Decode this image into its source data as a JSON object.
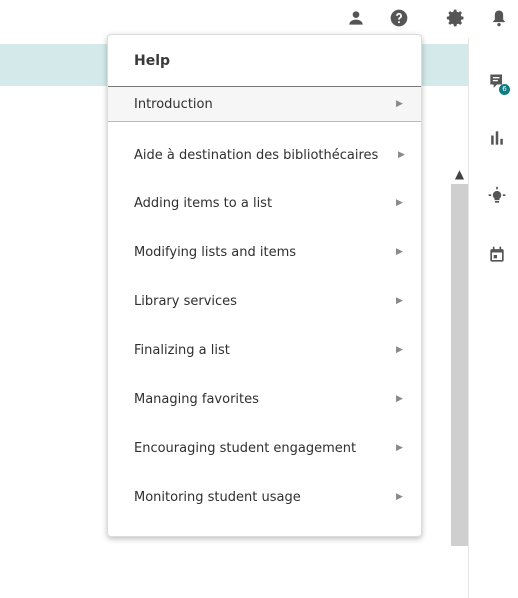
{
  "menu": {
    "title": "Help",
    "items": [
      {
        "label": "Introduction"
      },
      {
        "label": "Aide à destination des bibliothécaires"
      },
      {
        "label": "Adding items to a list"
      },
      {
        "label": "Modifying lists and items"
      },
      {
        "label": "Library services"
      },
      {
        "label": "Finalizing a list"
      },
      {
        "label": "Managing favorites"
      },
      {
        "label": "Encouraging student engagement"
      },
      {
        "label": "Monitoring student usage"
      }
    ],
    "chevron": "▶"
  },
  "sidebar": {
    "notifications_badge": "6"
  },
  "colors": {
    "accent": "#0f7d83",
    "header_strip": "#d3e9ea"
  }
}
